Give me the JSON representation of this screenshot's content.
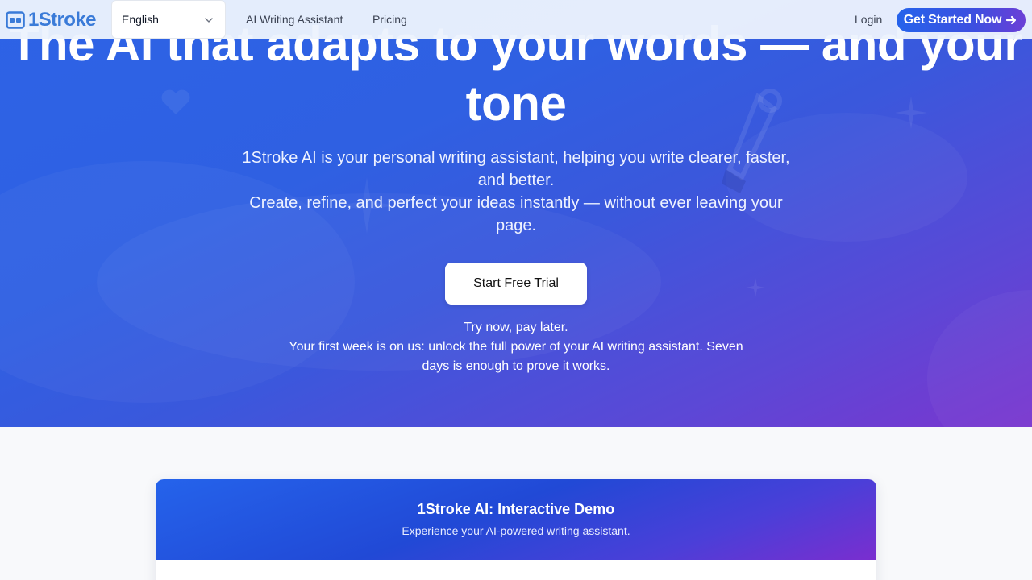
{
  "brand": {
    "name": "1Stroke",
    "accent": "#3a7bd8"
  },
  "nav": {
    "language": {
      "selected": "English"
    },
    "links": [
      "AI Writing Assistant",
      "Pricing"
    ],
    "login": "Login",
    "cta": "Get Started Now",
    "cta_icon": "arrow-right-icon"
  },
  "hero": {
    "title": "The AI that adapts to your words — and your tone",
    "subtitle_1": "1Stroke AI is your personal writing assistant, helping you write clearer, faster, and better.",
    "subtitle_2": "Create, refine, and perfect your ideas instantly — without ever leaving your page.",
    "trial_button": "Start Free Trial",
    "note_1": "Try now, pay later.",
    "note_2": "Your first week is on us: unlock the full power of your AI writing assistant. Seven days is enough to prove it works.",
    "gradient_start": "#2d63e6",
    "gradient_end": "#7a36cf"
  },
  "demo": {
    "title": "1Stroke AI: Interactive Demo",
    "subtitle": "Experience your AI-powered writing assistant."
  }
}
